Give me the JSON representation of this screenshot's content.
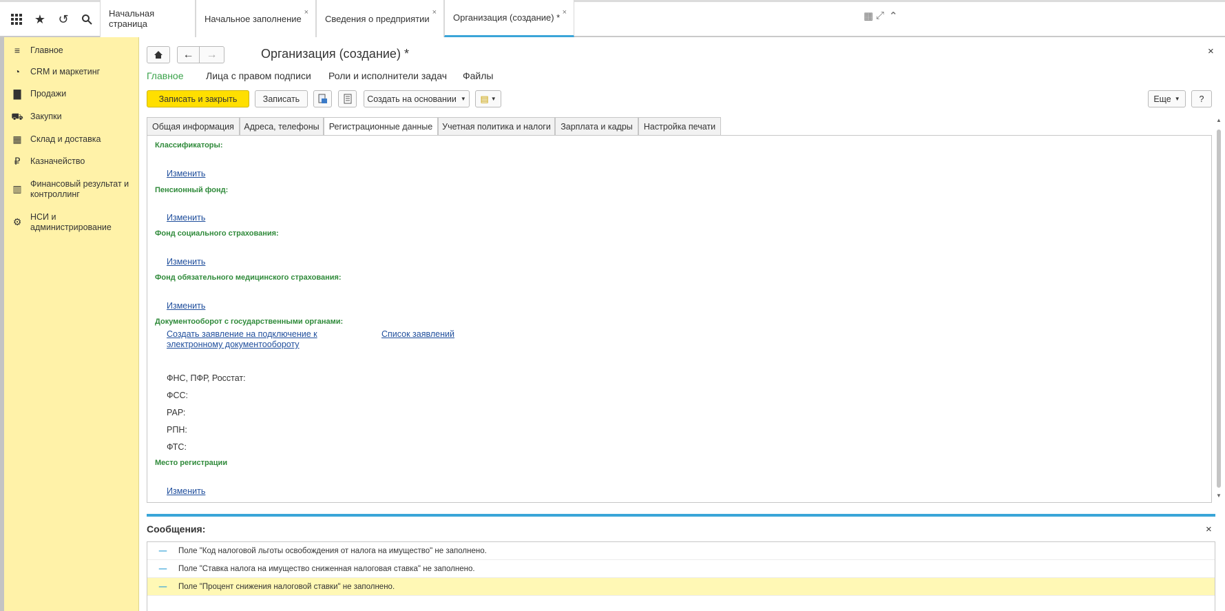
{
  "topbar": {
    "tabs": [
      {
        "label": "Начальная страница",
        "close": ""
      },
      {
        "label": "Начальное заполнение",
        "close": "×"
      },
      {
        "label": "Сведения о предприятии",
        "close": "×"
      },
      {
        "label": "Организация (создание) *",
        "close": "×"
      }
    ]
  },
  "sidebar": {
    "items": [
      {
        "label": "Главное",
        "icon": "≡"
      },
      {
        "label": "CRM и маркетинг",
        "icon": "◔"
      },
      {
        "label": "Продажи",
        "icon": "▇"
      },
      {
        "label": "Закупки",
        "icon": "⛟"
      },
      {
        "label": "Склад и доставка",
        "icon": "▦"
      },
      {
        "label": "Казначейство",
        "icon": "₽"
      },
      {
        "label": "Финансовый результат и контроллинг",
        "icon": "▥"
      },
      {
        "label": "НСИ и администрирование",
        "icon": "⚙"
      }
    ]
  },
  "form": {
    "title": "Организация (создание) *",
    "close": "×",
    "nav_tabs": [
      "Главное",
      "Лица с правом подписи",
      "Роли и исполнители задач",
      "Файлы"
    ],
    "toolbar": {
      "save_close": "Записать и закрыть",
      "save": "Записать",
      "create_based": "Создать на основании",
      "more": "Еще",
      "help": "?"
    },
    "tabs": [
      "Общая информация",
      "Адреса, телефоны",
      "Регистрационные данные",
      "Учетная политика и налоги",
      "Зарплата и кадры",
      "Настройка печати"
    ],
    "sections": {
      "classifiers": "Классификаторы:",
      "pension": "Пенсионный фонд:",
      "social": "Фонд социального страхования:",
      "medical": "Фонд обязательного медицинского страхования:",
      "docflow": "Документооборот с государственными органами:",
      "registration": "Место регистрации"
    },
    "change_link": "Изменить",
    "docflow_link1": "Создать заявление на подключение к электронному документообороту",
    "docflow_link2": "Список заявлений",
    "agencies": [
      "ФНС, ПФР, Росстат:",
      "ФСС:",
      "РАР:",
      "РПН:",
      "ФТС:"
    ]
  },
  "messages": {
    "title": "Сообщения:",
    "close": "×",
    "rows": [
      "Поле \"Код налоговой льготы освобождения от налога на имущество\" не заполнено.",
      "Поле \"Ставка налога на имущество сниженная налоговая ставка\" не заполнено.",
      "Поле \"Процент снижения налоговой ставки\" не заполнено."
    ]
  },
  "colors": {
    "accent_blue": "#3aa5d8",
    "section_green": "#2f8a3a",
    "primary_yellow": "#ffdf00",
    "sidebar_bg": "#fff2a8"
  }
}
